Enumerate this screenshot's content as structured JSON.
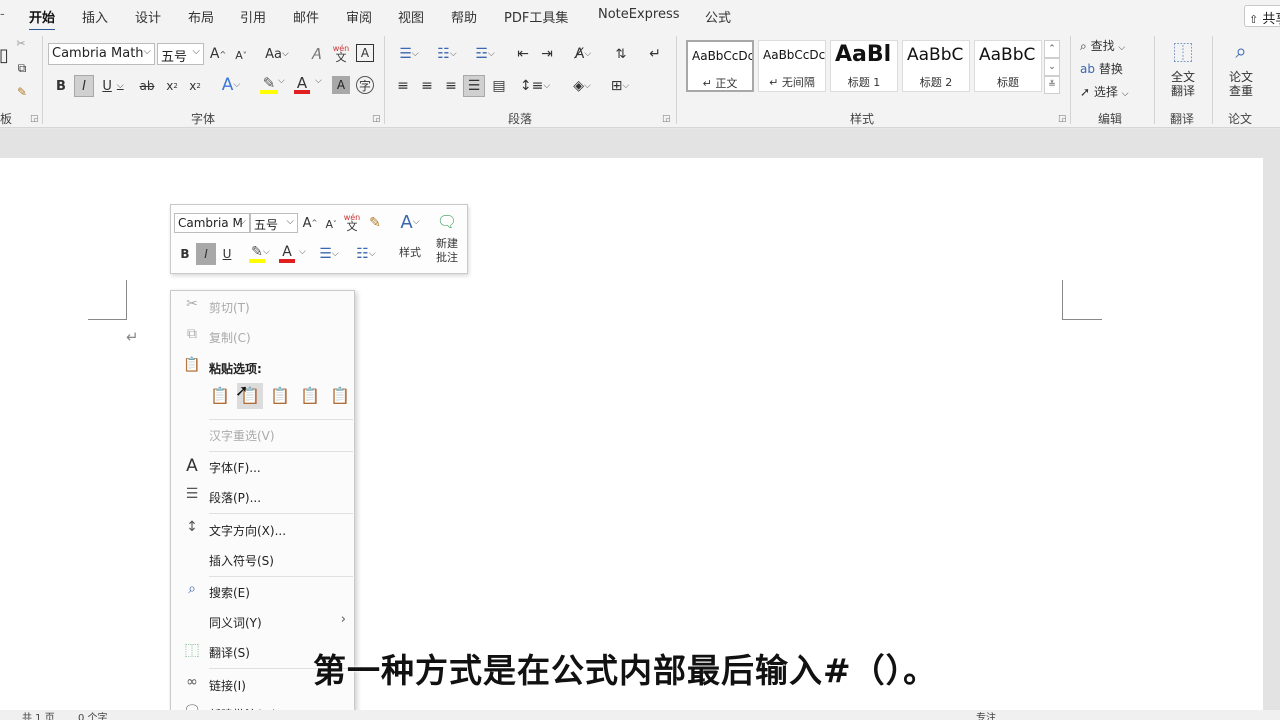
{
  "menubar": {
    "tabs": [
      {
        "label": "开始",
        "active": true
      },
      {
        "label": "插入"
      },
      {
        "label": "设计"
      },
      {
        "label": "布局"
      },
      {
        "label": "引用"
      },
      {
        "label": "邮件"
      },
      {
        "label": "审阅"
      },
      {
        "label": "视图"
      },
      {
        "label": "帮助"
      },
      {
        "label": "PDF工具集"
      },
      {
        "label": "NoteExpress"
      },
      {
        "label": "公式"
      }
    ],
    "share_label": "共享"
  },
  "ribbon": {
    "clipboard": {
      "label": "板"
    },
    "font": {
      "label": "字体",
      "font_name": "Cambria Math",
      "font_size": "五号",
      "grow_label": "A",
      "shrink_label": "A",
      "case_label": "Aa",
      "bold": "B",
      "italic": "I",
      "underline": "U",
      "strike": "ab",
      "subscript": "x",
      "superscript": "x",
      "phonetic_top": "wén",
      "phonetic_bottom": "文",
      "border_char": "A",
      "shade_char": "A"
    },
    "paragraph": {
      "label": "段落"
    },
    "styles": {
      "label": "样式",
      "items": [
        {
          "sample": "AaBbCcDc",
          "name": "↵ 正文"
        },
        {
          "sample": "AaBbCcDc",
          "name": "↵ 无间隔"
        },
        {
          "sample": "AaBl",
          "name": "标题 1"
        },
        {
          "sample": "AaBbC",
          "name": "标题 2"
        },
        {
          "sample": "AaBbC",
          "name": "标题"
        }
      ]
    },
    "editing": {
      "label": "编辑",
      "find": "查找",
      "replace": "替换",
      "select": "选择"
    },
    "translate": {
      "label": "翻译",
      "button_line1": "全文",
      "button_line2": "翻译"
    },
    "paper": {
      "label": "论文",
      "button_line1": "论文",
      "button_line2": "查重"
    }
  },
  "mini_toolbar": {
    "font_name": "Cambria M",
    "font_size": "五号",
    "styles_label": "样式",
    "comment_line1": "新建",
    "comment_line2": "批注",
    "bold": "B",
    "italic": "I",
    "underline": "U",
    "color_char": "A"
  },
  "context_menu": {
    "cut": "剪切(T)",
    "copy": "复制(C)",
    "paste_header": "粘贴选项:",
    "reconvert": "汉字重选(V)",
    "font": "字体(F)...",
    "paragraph": "段落(P)...",
    "text_direction": "文字方向(X)...",
    "insert_symbol": "插入符号(S)",
    "search": "搜索(E)",
    "synonyms": "同义词(Y)",
    "translate": "翻译(S)",
    "link": "链接(I)",
    "new_comment": "新建批注(M)"
  },
  "statusbar": {
    "page": "共 1 页",
    "words": "0 个字",
    "focus": "专注"
  },
  "subtitle": "第一种方式是在公式内部最后输入#（）。"
}
